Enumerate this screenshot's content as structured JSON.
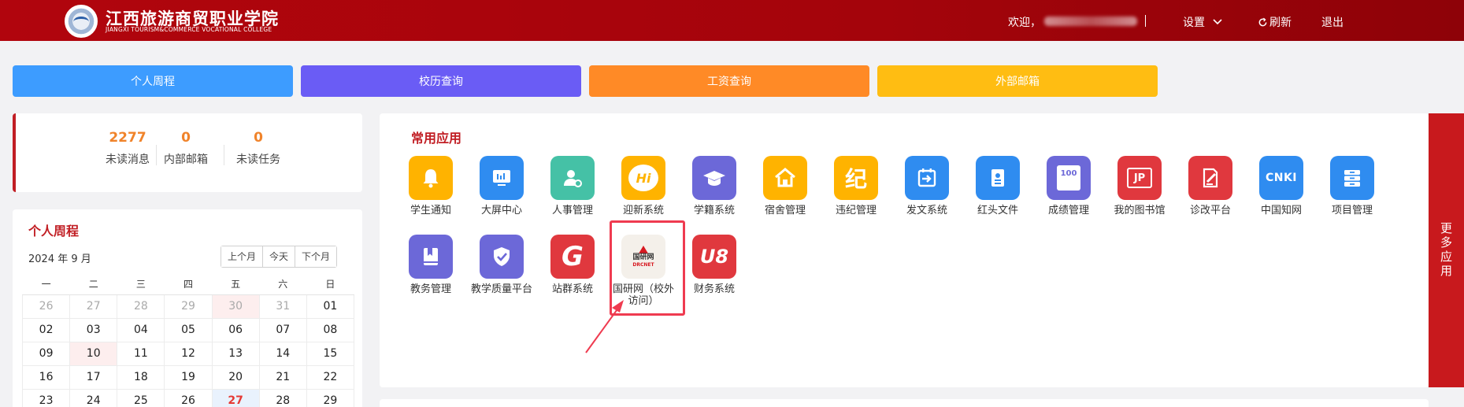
{
  "header": {
    "school_name_cn": "江西旅游商贸职业学院",
    "school_name_en": "JIANGXI TOURISM&COMMERCE VOCATIONAL COLLEGE",
    "welcome": "欢迎，",
    "separator": "|",
    "settings": "设置",
    "refresh": "刷新",
    "logout": "退出"
  },
  "quick_buttons": [
    {
      "label": "个人周程",
      "color": "#3d9cff"
    },
    {
      "label": "校历查询",
      "color": "#6a5cf5"
    },
    {
      "label": "工资查询",
      "color": "#ff8a26"
    },
    {
      "label": "外部邮箱",
      "color": "#ffbd12"
    }
  ],
  "stats": [
    {
      "value": "2277",
      "label": "未读消息"
    },
    {
      "value": "0",
      "label": "内部邮箱"
    },
    {
      "value": "0",
      "label": "未读任务"
    }
  ],
  "calendar": {
    "title": "个人周程",
    "month": "2024 年 9 月",
    "buttons": [
      "上个月",
      "今天",
      "下个月"
    ],
    "weekdays": [
      "一",
      "二",
      "三",
      "四",
      "五",
      "六",
      "日"
    ],
    "weeks": [
      [
        "26",
        "27",
        "28",
        "29",
        "30",
        "31",
        "01"
      ],
      [
        "02",
        "03",
        "04",
        "05",
        "06",
        "07",
        "08"
      ],
      [
        "09",
        "10",
        "11",
        "12",
        "13",
        "14",
        "15"
      ],
      [
        "16",
        "17",
        "18",
        "19",
        "20",
        "21",
        "22"
      ],
      [
        "23",
        "24",
        "25",
        "26",
        "27",
        "28",
        "29"
      ]
    ]
  },
  "apps": {
    "title": "常用应用",
    "row1": [
      {
        "label": "学生通知",
        "icon": "bell-icon",
        "color": "#ffb300"
      },
      {
        "label": "大屏中心",
        "icon": "monitor-icon",
        "color": "#2f8cf0"
      },
      {
        "label": "人事管理",
        "icon": "user-gear-icon",
        "color": "#45c1a6"
      },
      {
        "label": "迎新系统",
        "icon": "hi-bubble-icon",
        "color": "#ffb300",
        "glyph": "Hi"
      },
      {
        "label": "学籍系统",
        "icon": "graduation-cap-icon",
        "color": "#6c68d8"
      },
      {
        "label": "宿舍管理",
        "icon": "house-icon",
        "color": "#ffb300"
      },
      {
        "label": "违纪管理",
        "icon": "ji-char-icon",
        "color": "#ffb300",
        "glyph": "纪"
      },
      {
        "label": "发文系统",
        "icon": "calendar-arrow-icon",
        "color": "#2f8cf0"
      },
      {
        "label": "红头文件",
        "icon": "file-icon",
        "color": "#2f8cf0"
      },
      {
        "label": "成绩管理",
        "icon": "score-edit-icon",
        "color": "#6c68d8",
        "glyph": "100"
      },
      {
        "label": "我的图书馆",
        "icon": "jp-book-icon",
        "color": "#e0383e",
        "glyph": "JP"
      },
      {
        "label": "诊改平台",
        "icon": "document-pen-icon",
        "color": "#e0383e"
      },
      {
        "label": "中国知网",
        "icon": "cnki-icon",
        "color": "#2f8cf0",
        "glyph": "CNKI"
      },
      {
        "label": "项目管理",
        "icon": "drawers-icon",
        "color": "#2f8cf0"
      }
    ],
    "row2": [
      {
        "label": "教务管理",
        "icon": "book-bookmark-icon",
        "color": "#6c68d8"
      },
      {
        "label": "教学质量平台",
        "icon": "shield-check-icon",
        "color": "#6c68d8"
      },
      {
        "label": "站群系统",
        "icon": "g-letter-icon",
        "color": "#e0383e",
        "glyph": "G"
      },
      {
        "label": "国研网（校外访问）",
        "icon": "drcnet-logo-icon",
        "color": "#f4f0ea",
        "glyph": "国研网",
        "sub_glyph": "DRCNET"
      },
      {
        "label": "财务系统",
        "icon": "u8-icon",
        "color": "#e0383e",
        "glyph": "U8"
      }
    ],
    "more": "更多应用"
  }
}
